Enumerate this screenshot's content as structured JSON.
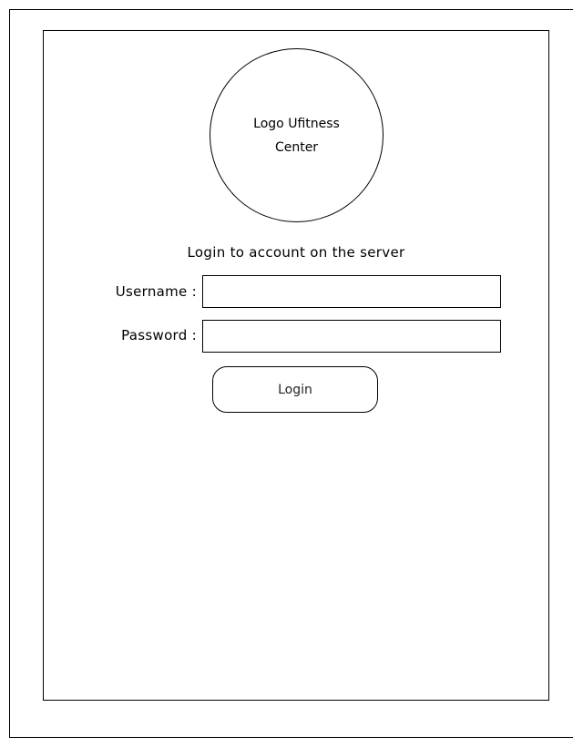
{
  "logo": {
    "text_line1": "Logo Ufitness",
    "text_line2": "Center"
  },
  "login_form": {
    "heading": "Login to account on the server",
    "username_label": "Username :",
    "username_value": "",
    "password_label": "Password :",
    "password_value": "",
    "login_button_label": "Login"
  },
  "colors": {
    "border": "#000000",
    "background": "#ffffff"
  }
}
